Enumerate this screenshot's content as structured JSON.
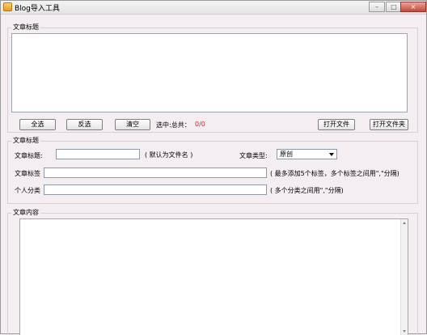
{
  "window": {
    "title": "Blog导入工具",
    "minimize": "–",
    "maximize": "□",
    "close": "×"
  },
  "file_group": {
    "label": "文章标题",
    "buttons": {
      "select_all": "全选",
      "invert": "反选",
      "clear": "清空",
      "open_file": "打开文件",
      "open_folder": "打开文件夹"
    },
    "selected_label": "选中:总共：",
    "selected_count": "0/0"
  },
  "meta_group": {
    "label": "文章标题",
    "title_label": "文章标题:",
    "title_value": "",
    "title_hint": "( 默认为文件名 )",
    "type_label": "文章类型:",
    "type_selected": "原创",
    "tags_label": "文章标签",
    "tags_value": "",
    "tags_hint": "( 最多添加5个标签，多个标签之间用\",\"分隔)",
    "category_label": "个人分类",
    "category_value": "",
    "category_hint": "( 多个分类之间用\",\"分隔)"
  },
  "content_group": {
    "label": "文章内容",
    "value": ""
  }
}
